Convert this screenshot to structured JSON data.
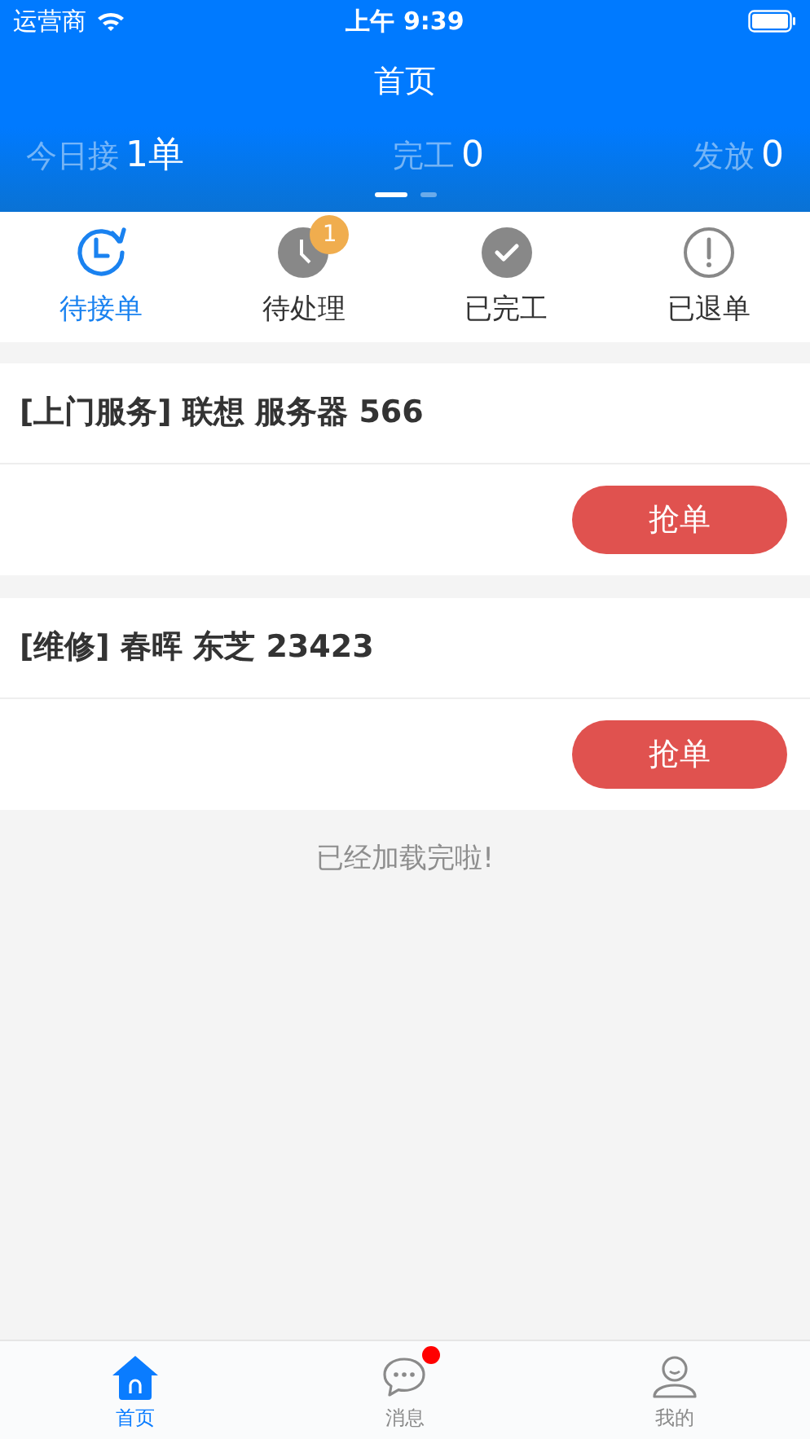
{
  "status_bar": {
    "carrier": "运营商",
    "time": "上午 9:39"
  },
  "header": {
    "title": "首页"
  },
  "stats": [
    {
      "label": "今日接",
      "value": "1单"
    },
    {
      "label": "完工",
      "value": "0"
    },
    {
      "label": "发放",
      "value": "0"
    }
  ],
  "page_dots": [
    {
      "selected": true
    },
    {
      "selected": false
    }
  ],
  "tabs": [
    {
      "kind": "refresh-clock",
      "label": "待接单",
      "selected": true
    },
    {
      "kind": "clock",
      "label": "待处理",
      "selected": false,
      "badge": "1"
    },
    {
      "kind": "check",
      "label": "已完工",
      "selected": false
    },
    {
      "kind": "alert",
      "label": "已退单",
      "selected": false
    }
  ],
  "orders": [
    {
      "title": "[上门服务] 联想 服务器 566",
      "button": "抢单"
    },
    {
      "title": "[维修] 春晖 东芝 23423",
      "button": "抢单"
    }
  ],
  "list_end": "已经加载完啦!",
  "tab_bar": [
    {
      "kind": "home",
      "label": "首页",
      "selected": true,
      "unread": false
    },
    {
      "kind": "chat",
      "label": "消息",
      "selected": false,
      "unread": true
    },
    {
      "kind": "person",
      "label": "我的",
      "selected": false,
      "unread": false
    }
  ]
}
